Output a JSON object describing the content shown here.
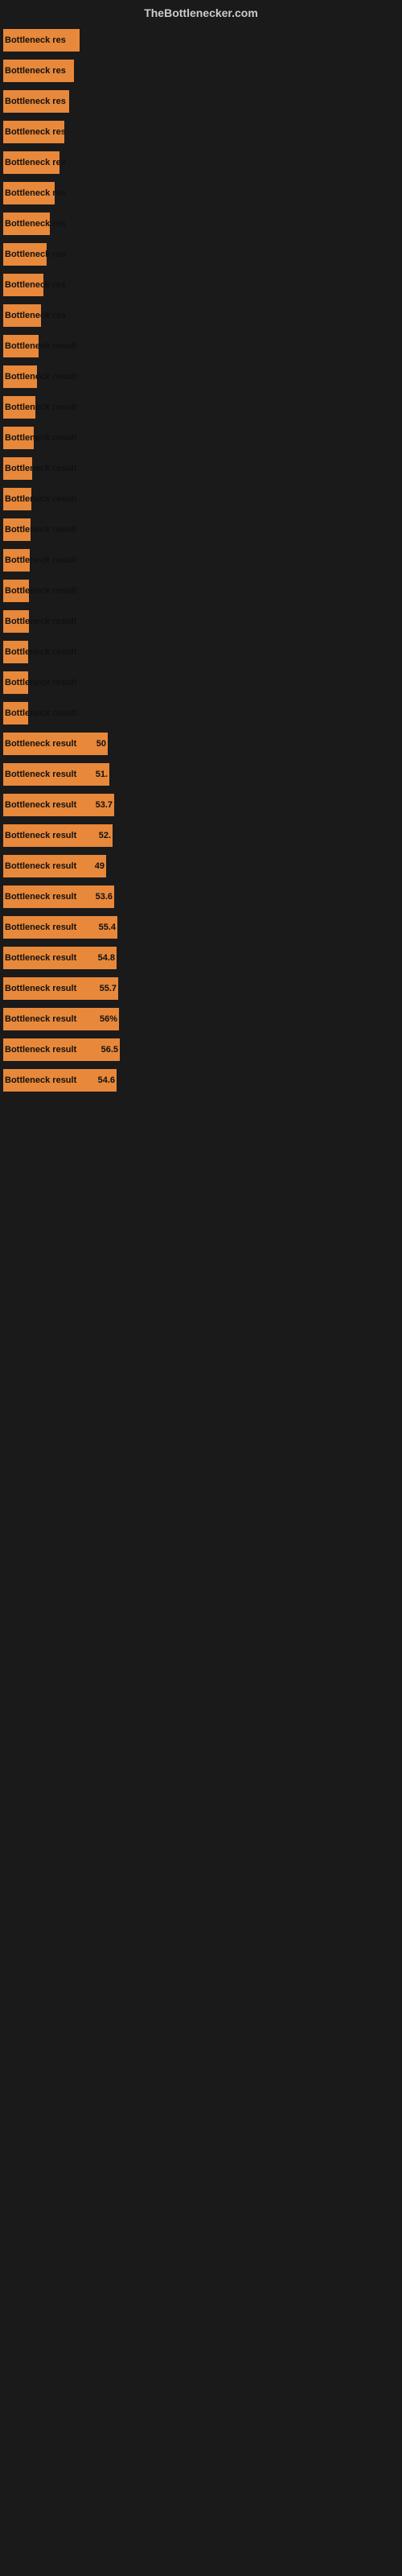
{
  "header": {
    "title": "TheBottlenecker.com"
  },
  "bars": [
    {
      "label": "Bottleneck res",
      "value": "",
      "width": 95
    },
    {
      "label": "Bottleneck res",
      "value": "",
      "width": 88
    },
    {
      "label": "Bottleneck res",
      "value": "",
      "width": 82
    },
    {
      "label": "Bottleneck res",
      "value": "",
      "width": 76
    },
    {
      "label": "Bottleneck res",
      "value": "",
      "width": 70
    },
    {
      "label": "Bottleneck res",
      "value": "",
      "width": 64
    },
    {
      "label": "Bottleneck res",
      "value": "",
      "width": 58
    },
    {
      "label": "Bottleneck res",
      "value": "",
      "width": 54
    },
    {
      "label": "Bottleneck res",
      "value": "",
      "width": 50
    },
    {
      "label": "Bottleneck res",
      "value": "",
      "width": 47
    },
    {
      "label": "Bottleneck result",
      "value": "",
      "width": 44
    },
    {
      "label": "Bottleneck result",
      "value": "",
      "width": 42
    },
    {
      "label": "Bottleneck result",
      "value": "",
      "width": 40
    },
    {
      "label": "Bottleneck result",
      "value": "",
      "width": 38
    },
    {
      "label": "Bottleneck result",
      "value": "",
      "width": 36
    },
    {
      "label": "Bottleneck result",
      "value": "",
      "width": 35
    },
    {
      "label": "Bottleneck result",
      "value": "",
      "width": 34
    },
    {
      "label": "Bottleneck result",
      "value": "",
      "width": 33
    },
    {
      "label": "Bottleneck result",
      "value": "",
      "width": 32
    },
    {
      "label": "Bottleneck result",
      "value": "",
      "width": 32
    },
    {
      "label": "Bottleneck result",
      "value": "",
      "width": 31
    },
    {
      "label": "Bottleneck result",
      "value": "",
      "width": 31
    },
    {
      "label": "Bottleneck result",
      "value": "",
      "width": 31
    },
    {
      "label": "Bottleneck result",
      "value": "50",
      "width": 130
    },
    {
      "label": "Bottleneck result",
      "value": "51.",
      "width": 132
    },
    {
      "label": "Bottleneck result",
      "value": "53.7",
      "width": 138
    },
    {
      "label": "Bottleneck result",
      "value": "52.",
      "width": 136
    },
    {
      "label": "Bottleneck result",
      "value": "49",
      "width": 128
    },
    {
      "label": "Bottleneck result",
      "value": "53.6",
      "width": 138
    },
    {
      "label": "Bottleneck result",
      "value": "55.4",
      "width": 142
    },
    {
      "label": "Bottleneck result",
      "value": "54.8",
      "width": 141
    },
    {
      "label": "Bottleneck result",
      "value": "55.7",
      "width": 143
    },
    {
      "label": "Bottleneck result",
      "value": "56%",
      "width": 144
    },
    {
      "label": "Bottleneck result",
      "value": "56.5",
      "width": 145
    },
    {
      "label": "Bottleneck result",
      "value": "54.6",
      "width": 141
    }
  ]
}
